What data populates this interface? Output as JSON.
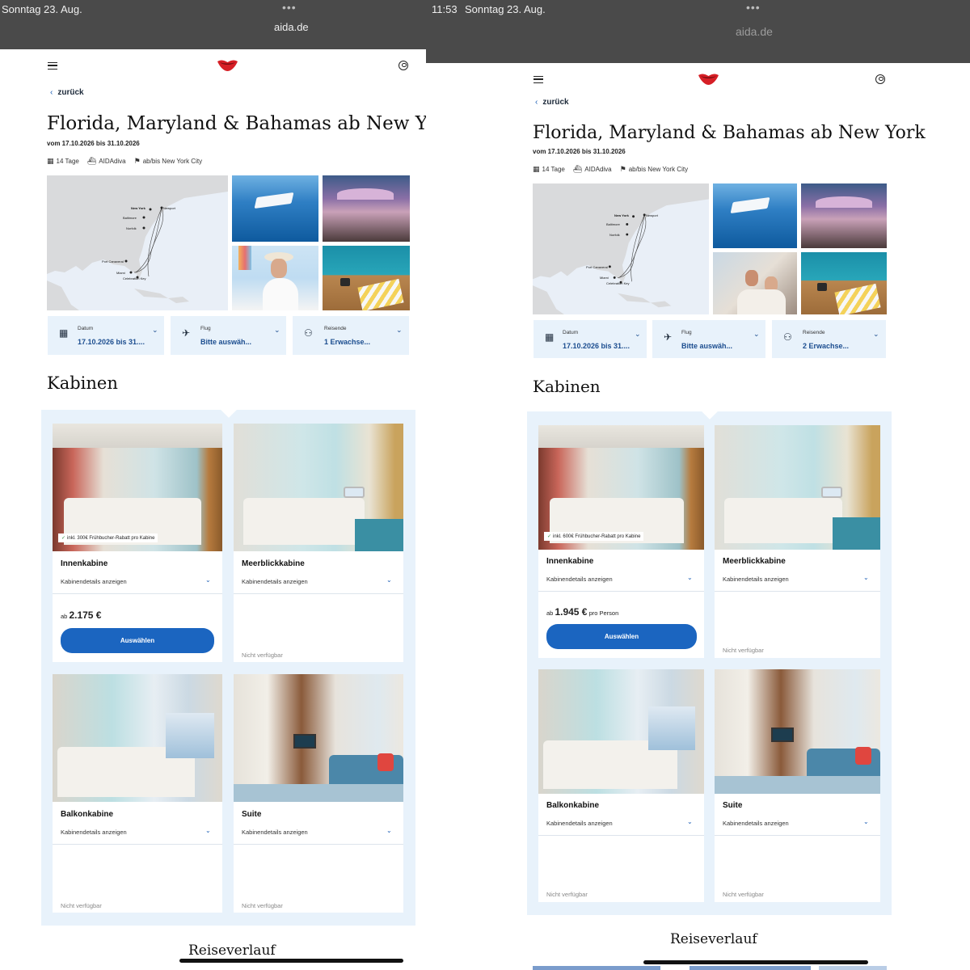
{
  "left": {
    "status_date": "Sonntag 23. Aug.",
    "status_dots": "•••",
    "url": "aida.de",
    "back_label": "zurück",
    "title": "Florida, Maryland & Bahamas ab New York",
    "dates": "vom 17.10.2026 bis 31.10.2026",
    "meta": {
      "duration": "14 Tage",
      "ship": "AIDAdiva",
      "port": "ab/bis New York City"
    },
    "map_labels": [
      "New York",
      "Newport",
      "Baltimore",
      "Norfolk",
      "Port Canaveral",
      "Miami",
      "Celebration Key"
    ],
    "selectors": [
      {
        "label": "Datum",
        "value": "17.10.2026 bis 31...."
      },
      {
        "label": "Flug",
        "value": "Bitte auswäh..."
      },
      {
        "label": "Reisende",
        "value": "1 Erwachse..."
      }
    ],
    "cabins_heading": "Kabinen",
    "cabins": [
      {
        "name": "Innenkabine",
        "details": "Kabinendetails anzeigen",
        "badge": "inkl. 300€ Frühbucher-Rabatt pro Kabine",
        "price_prefix": "ab",
        "price": "2.175 €",
        "price_suffix": "",
        "button": "Auswählen"
      },
      {
        "name": "Meerblickkabine",
        "details": "Kabinendetails anzeigen",
        "unavailable": "Nicht verfügbar"
      },
      {
        "name": "Balkonkabine",
        "details": "Kabinendetails anzeigen",
        "unavailable": "Nicht verfügbar"
      },
      {
        "name": "Suite",
        "details": "Kabinendetails anzeigen",
        "unavailable": "Nicht verfügbar"
      }
    ],
    "itinerary_heading": "Reiseverlauf"
  },
  "right": {
    "status_time": "11:53",
    "status_date": "Sonntag 23. Aug.",
    "status_dots": "•••",
    "url": "aida.de",
    "back_label": "zurück",
    "title": "Florida, Maryland & Bahamas ab New York",
    "dates": "vom 17.10.2026 bis 31.10.2026",
    "meta": {
      "duration": "14 Tage",
      "ship": "AIDAdiva",
      "port": "ab/bis New York City"
    },
    "map_labels": [
      "New York",
      "Newport",
      "Baltimore",
      "Norfolk",
      "Port Canaveral",
      "Miami",
      "Celebration Key"
    ],
    "selectors": [
      {
        "label": "Datum",
        "value": "17.10.2026 bis 31...."
      },
      {
        "label": "Flug",
        "value": "Bitte auswäh..."
      },
      {
        "label": "Reisende",
        "value": "2 Erwachse..."
      }
    ],
    "cabins_heading": "Kabinen",
    "cabins": [
      {
        "name": "Innenkabine",
        "details": "Kabinendetails anzeigen",
        "badge": "inkl. 600€ Frühbucher-Rabatt pro Kabine",
        "price_prefix": "ab",
        "price": "1.945 €",
        "price_suffix": "pro Person",
        "button": "Auswählen"
      },
      {
        "name": "Meerblickkabine",
        "details": "Kabinendetails anzeigen",
        "unavailable": "Nicht verfügbar"
      },
      {
        "name": "Balkonkabine",
        "details": "Kabinendetails anzeigen",
        "unavailable": "Nicht verfügbar"
      },
      {
        "name": "Suite",
        "details": "Kabinendetails anzeigen",
        "unavailable": "Nicht verfügbar"
      }
    ],
    "itinerary_heading": "Reiseverlauf"
  },
  "colors": {
    "accent": "#1b65c0",
    "light_blue_bg": "#e8f2fb",
    "status_bar": "#4a4a4a",
    "logo_red": "#d61f26"
  },
  "icons": [
    "menu-icon",
    "aida-kussmund-logo",
    "account-icon",
    "chevron-left-icon",
    "calendar-icon",
    "ship-icon",
    "flag-icon",
    "plane-icon",
    "people-icon",
    "chevron-down-icon",
    "check-icon"
  ]
}
